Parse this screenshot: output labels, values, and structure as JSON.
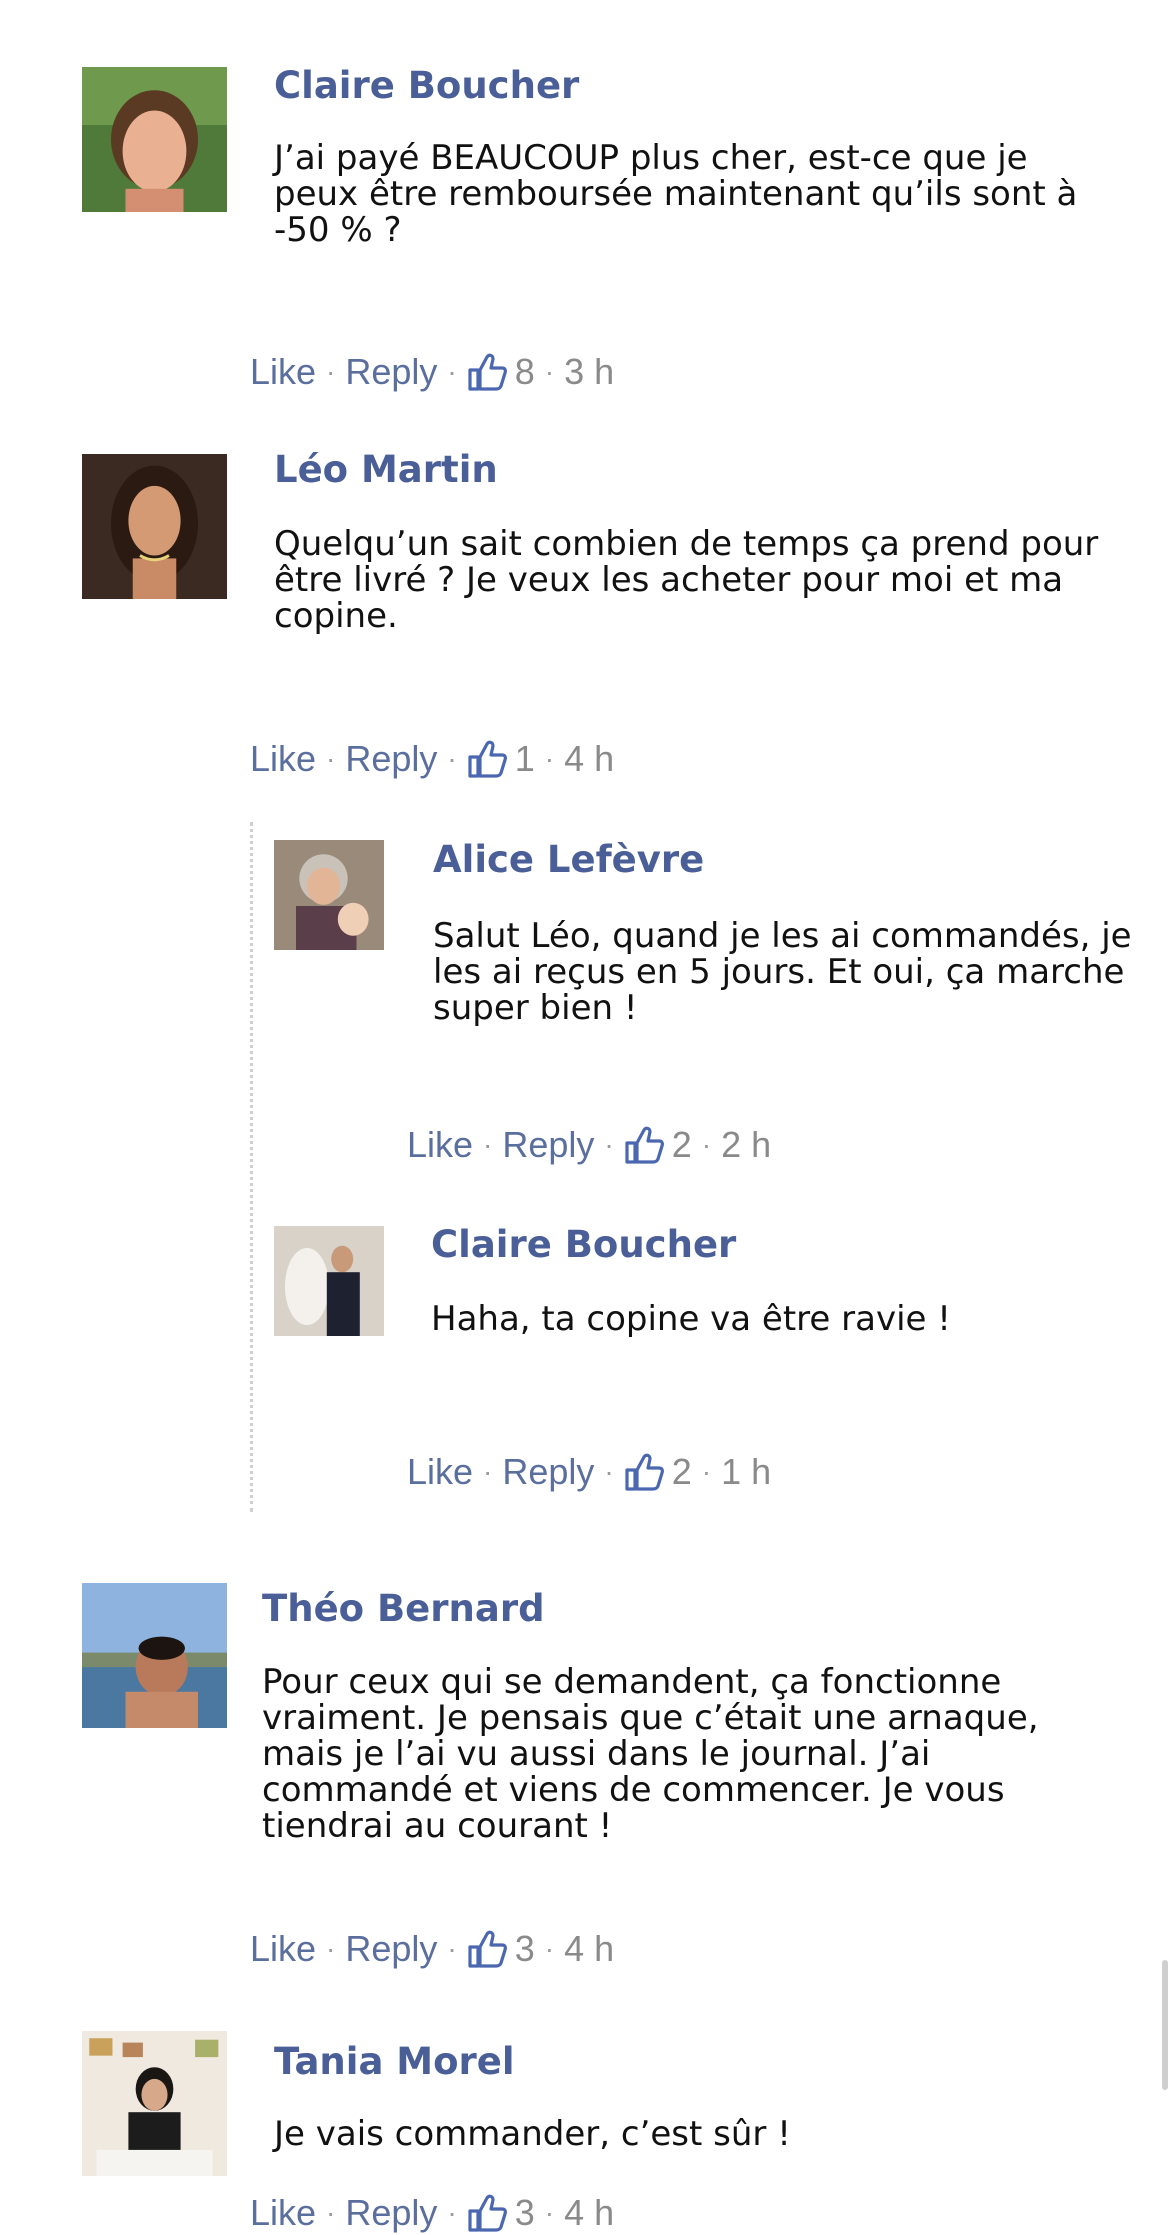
{
  "actions": {
    "like": "Like",
    "reply": "Reply",
    "sep": "·"
  },
  "comments": [
    {
      "name": "Claire Boucher",
      "text": "J’ai payé BEAUCOUP plus cher, est-ce que je peux être remboursée maintenant qu’ils sont à -50 % ?",
      "likes": "8",
      "time": "3 h"
    },
    {
      "name": "Léo Martin",
      "text": "Quelqu’un sait combien de temps ça prend pour être livré ? Je veux les acheter pour moi et ma copine.",
      "likes": "1",
      "time": "4 h"
    },
    {
      "name": "Alice Lefèvre",
      "text": "Salut Léo, quand je les ai commandés, je les ai reçus en 5 jours. Et oui, ça marche super bien !",
      "likes": "2",
      "time": "2 h"
    },
    {
      "name": "Claire Boucher",
      "text": "Haha, ta copine va être ravie !",
      "likes": "2",
      "time": "1 h"
    },
    {
      "name": "Théo Bernard",
      "text": "Pour ceux qui se demandent, ça fonctionne vraiment. Je pensais que c’était une arnaque, mais je l’ai vu aussi dans le journal. J’ai commandé et viens de commencer. Je vous tiendrai au courant !",
      "likes": "3",
      "time": "4 h"
    },
    {
      "name": "Tania Morel",
      "text": "Je vais commander, c’est sûr !",
      "likes": "3",
      "time": "4 h"
    }
  ],
  "colors": {
    "name": "#4a5f98",
    "link": "#5b6f9f",
    "meta": "#8a8a8a",
    "thumb": "#4a67b0"
  }
}
